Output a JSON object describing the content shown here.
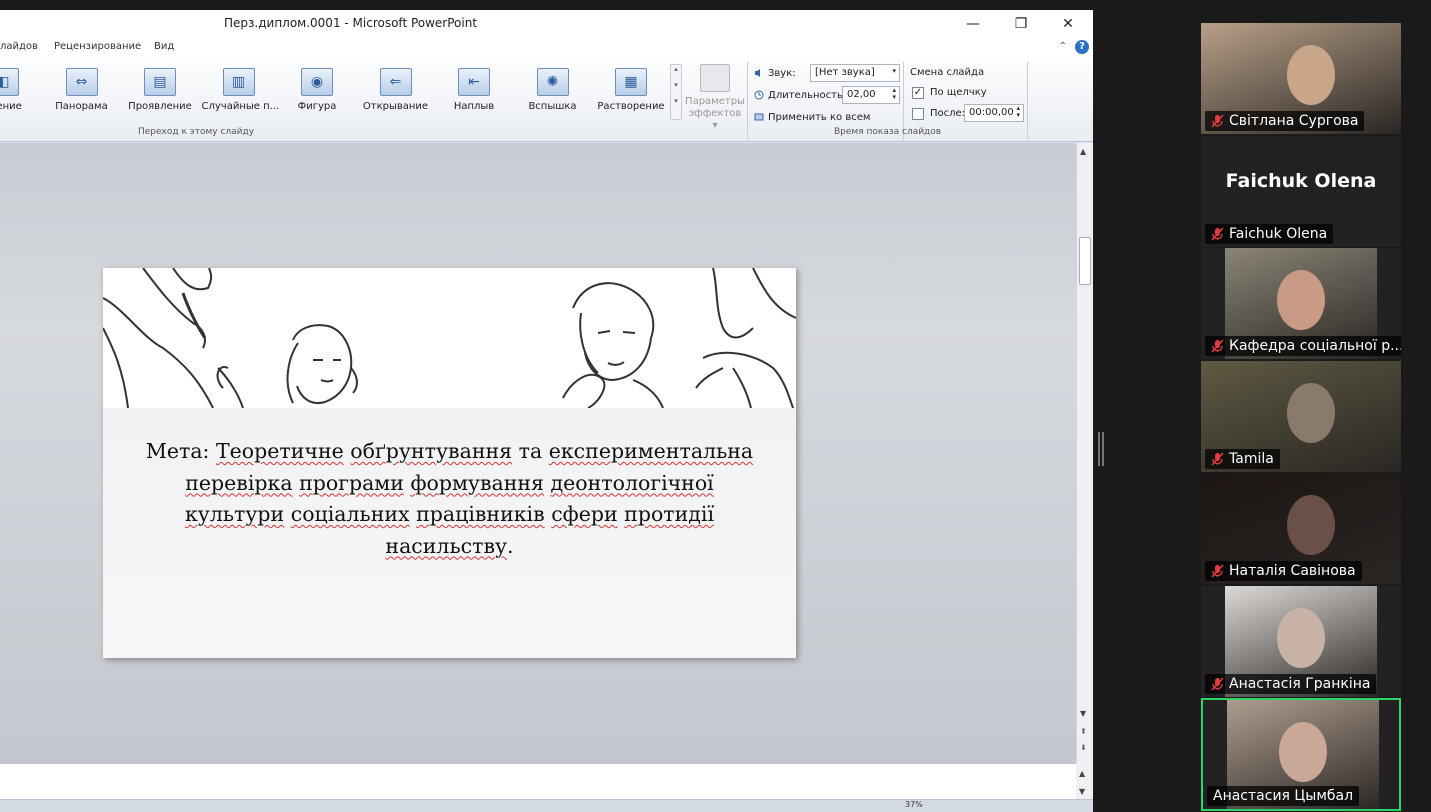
{
  "window": {
    "title": "Перз.диплом.0001  -  Microsoft PowerPoint",
    "minimize": "—",
    "restore": "❐",
    "close": "✕"
  },
  "menu": {
    "items": [
      "лайдов",
      "Рецензирование",
      "Вид"
    ],
    "minimize_ribbon": "⌃",
    "help": "?"
  },
  "ribbon": {
    "transitions": [
      {
        "label": "вление",
        "icon": "transition-icon"
      },
      {
        "label": "Панорама",
        "icon": "pan-icon"
      },
      {
        "label": "Проявление",
        "icon": "reveal-icon"
      },
      {
        "label": "Случайные п...",
        "icon": "random-bars-icon"
      },
      {
        "label": "Фигура",
        "icon": "shape-icon"
      },
      {
        "label": "Открывание",
        "icon": "uncover-icon"
      },
      {
        "label": "Наплыв",
        "icon": "cover-icon"
      },
      {
        "label": "Вспышка",
        "icon": "flash-icon"
      },
      {
        "label": "Растворение",
        "icon": "dissolve-icon"
      }
    ],
    "effect_params_label_1": "Параметры",
    "effect_params_label_2": "эффектов ▾",
    "group_transition_label": "Переход к этому слайду",
    "group_timing_label": "Время показа слайдов",
    "sound_label": "Звук:",
    "sound_value": "[Нет звука]",
    "duration_label": "Длительность:",
    "duration_value": "02,00",
    "apply_all_label": "Применить ко всем",
    "advance_title": "Смена слайда",
    "on_click_label": "По щелчку",
    "on_click_checked": true,
    "after_label": "После:",
    "after_checked": false,
    "after_value": "00:00,00"
  },
  "slide": {
    "goal_label": "Мета:",
    "goal_text_words": [
      "Теоретичне",
      "обґрунтування",
      "та",
      "експериментальна",
      "перевірка",
      "програми",
      "формування",
      "деонтологічної",
      "культури",
      "соціальних",
      "працівників",
      "сфери",
      "протидії",
      "насильству"
    ],
    "goal_end": "."
  },
  "status": {
    "zoom": "37%"
  },
  "participants": [
    {
      "name": "Світлана Сургова",
      "muted": true,
      "video": true,
      "active": false
    },
    {
      "name": "Faichuk Olena",
      "muted": true,
      "video": false,
      "active": false,
      "big_name": "Faichuk Olena"
    },
    {
      "name": "Кафедра соціальної р...",
      "muted": true,
      "video": true,
      "active": false
    },
    {
      "name": "Tamila",
      "muted": true,
      "video": true,
      "active": false
    },
    {
      "name": "Наталія Савінова",
      "muted": true,
      "video": true,
      "active": false
    },
    {
      "name": "Анастасія Гранкіна",
      "muted": true,
      "video": true,
      "active": false
    },
    {
      "name": "Анастасия Цымбал",
      "muted": false,
      "video": true,
      "active": true
    }
  ],
  "colors": {
    "active_speaker": "#2fd36b",
    "mute_icon": "#e03b3b"
  }
}
